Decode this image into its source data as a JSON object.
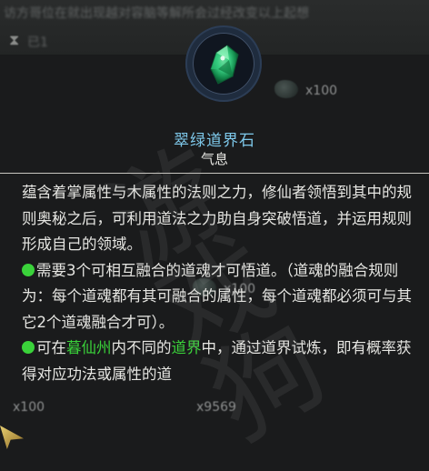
{
  "background": {
    "top_text": "访方哥位在就出现越对容脑等解所会过经改变以上起想",
    "top_sub": "已1",
    "quantities": [
      "x100",
      "x100",
      "x100",
      "x9569"
    ]
  },
  "item": {
    "name": "翠绿道界石",
    "tag": "气息",
    "icon": "emerald-gem-icon",
    "name_color": "#7ec8ea"
  },
  "description": {
    "para1": "蕴含着掌属性与木属性的法则之力，修仙者领悟到其中的规则奥秘之后，可利用道法之力助自身突破悟道，并运用规则形成自己的领域。",
    "para2": "需要3个可相互融合的道魂才可悟道。（道魂的融合规则为：每个道魂都有其可融合的属性，每个道魂都必须可与其它2个道魂融合才可）。",
    "para3_a": "可在",
    "para3_place": "暮仙州",
    "para3_b": "内不同的",
    "para3_realm": "道界",
    "para3_c": "中，通过道界试炼，即有概率获得对应功法或属性的道"
  },
  "watermark": "游戏狗"
}
